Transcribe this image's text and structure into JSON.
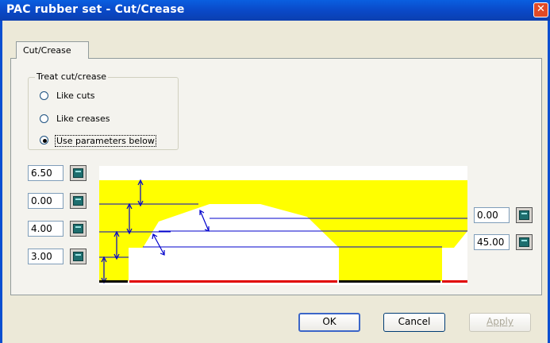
{
  "window": {
    "title": "PAC rubber set - Cut/Crease",
    "close_glyph": "✕"
  },
  "tabs": [
    {
      "label": "Cut/Crease",
      "selected": true
    }
  ],
  "treat_group": {
    "label": "Treat cut/crease",
    "options": [
      {
        "label": "Like cuts",
        "selected": false
      },
      {
        "label": "Like creases",
        "selected": false
      },
      {
        "label": "Use parameters below",
        "selected": true
      }
    ]
  },
  "left_fields": [
    {
      "value": "6.50",
      "icon": "calculator-icon"
    },
    {
      "value": "0.00",
      "icon": "calculator-icon"
    },
    {
      "value": "4.00",
      "icon": "calculator-icon"
    },
    {
      "value": "3.00",
      "icon": "calculator-icon"
    }
  ],
  "right_fields": [
    {
      "value": "0.00",
      "icon": "calculator-icon"
    },
    {
      "value": "45.00",
      "icon": "calculator-icon"
    }
  ],
  "colors": {
    "rubber_fill": "#FFFF00",
    "dimension_lines": "#0000CC",
    "cut_marker": "#E00000",
    "base_marker": "#000000"
  },
  "buttons": {
    "ok": "OK",
    "cancel": "Cancel",
    "apply": "Apply"
  }
}
